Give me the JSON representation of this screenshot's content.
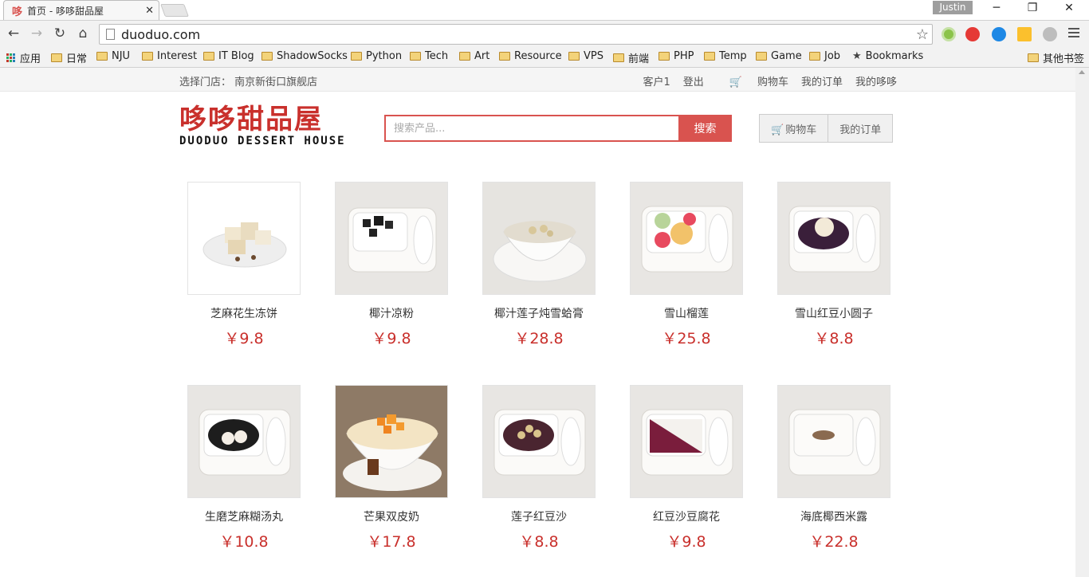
{
  "browser": {
    "tab_title": "首页 - 哆哆甜品屋",
    "tab_favicon": "哆",
    "profile_name": "Justin",
    "url": "duoduo.com",
    "bookmarks": [
      "应用",
      "日常",
      "NJU",
      "Interest",
      "IT Blog",
      "ShadowSocks",
      "Python",
      "Tech",
      "Art",
      "Resource",
      "VPS",
      "前端",
      "PHP",
      "Temp",
      "Game",
      "Job",
      "Bookmarks",
      "其他书签"
    ]
  },
  "topbar": {
    "store_label": "选择门店：",
    "store_name": "南京新街口旗舰店",
    "user": "客户1",
    "logout": "登出",
    "cart": "购物车",
    "orders": "我的订单",
    "my": "我的哆哆"
  },
  "header": {
    "logo_cn": "哆哆甜品屋",
    "logo_en": "DUODUO DESSERT HOUSE",
    "search_placeholder": "搜索产品...",
    "search_button": "搜索",
    "cart_button": "购物车",
    "orders_button": "我的订单"
  },
  "products": [
    {
      "name": "芝麻花生冻饼",
      "price": "￥9.8"
    },
    {
      "name": "椰汁凉粉",
      "price": "￥9.8"
    },
    {
      "name": "椰汁莲子炖雪蛤膏",
      "price": "￥28.8"
    },
    {
      "name": "雪山榴莲",
      "price": "￥25.8"
    },
    {
      "name": "雪山红豆小圆子",
      "price": "￥8.8"
    },
    {
      "name": "生磨芝麻糊汤丸",
      "price": "￥10.8"
    },
    {
      "name": "芒果双皮奶",
      "price": "￥17.8"
    },
    {
      "name": "莲子红豆沙",
      "price": "￥8.8"
    },
    {
      "name": "红豆沙豆腐花",
      "price": "￥9.8"
    },
    {
      "name": "海底椰西米露",
      "price": "￥22.8"
    }
  ],
  "colors": {
    "accent": "#d9534f",
    "price": "#c9302c"
  }
}
